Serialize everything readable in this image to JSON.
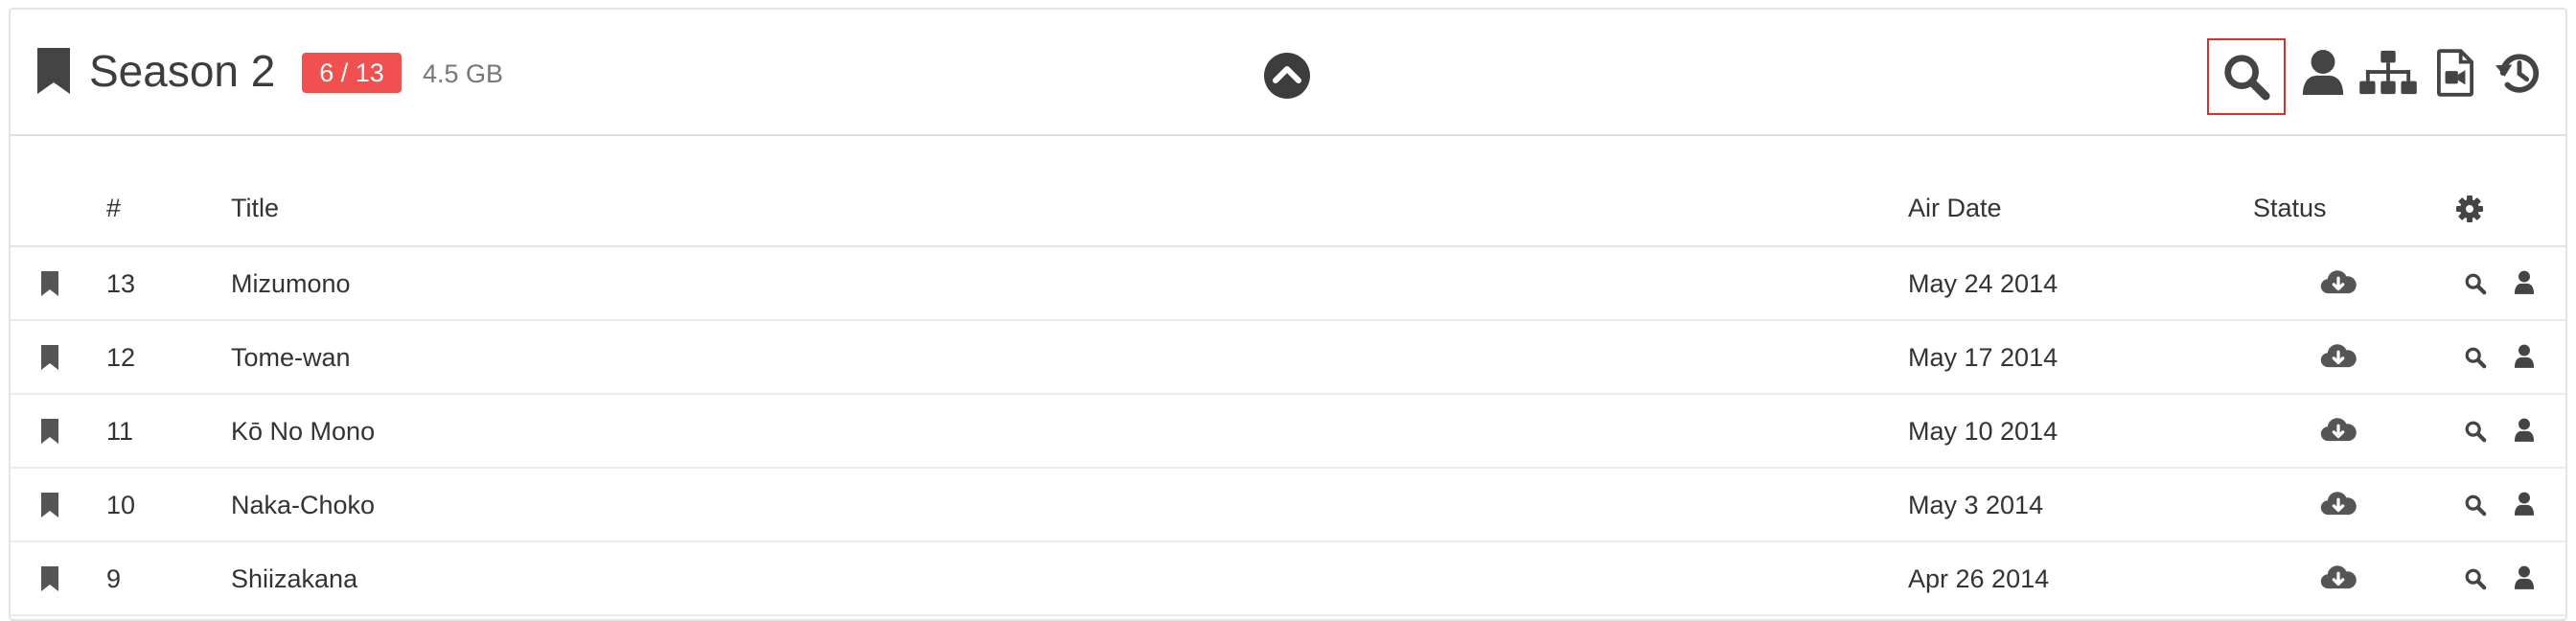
{
  "header": {
    "title": "Season 2",
    "badge": "6 / 13",
    "size": "4.5 GB",
    "icons": [
      "bookmark-icon",
      "chevron-up-circle-icon",
      "search-icon",
      "user-icon",
      "sitemap-icon",
      "file-video-icon",
      "history-icon"
    ]
  },
  "table": {
    "columns": {
      "number": "#",
      "title": "Title",
      "air_date": "Air Date",
      "status": "Status"
    },
    "rows": [
      {
        "number": "13",
        "title": "Mizumono",
        "air_date": "May 24 2014"
      },
      {
        "number": "12",
        "title": "Tome-wan",
        "air_date": "May 17 2014"
      },
      {
        "number": "11",
        "title": "Kō No Mono",
        "air_date": "May 10 2014"
      },
      {
        "number": "10",
        "title": "Naka-Choko",
        "air_date": "May 3 2014"
      },
      {
        "number": "9",
        "title": "Shiizakana",
        "air_date": "Apr 26 2014"
      }
    ]
  },
  "colors": {
    "badge": "#f05050",
    "icon": "#444444",
    "highlight": "#d9302f"
  }
}
